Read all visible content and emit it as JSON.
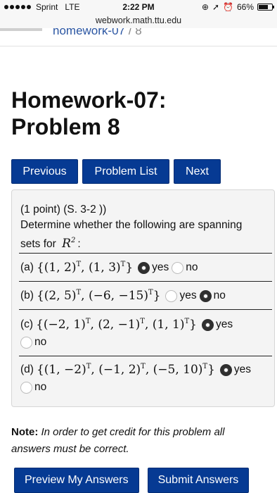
{
  "status_bar": {
    "carrier": "Sprint",
    "network": "LTE",
    "time": "2:22 PM",
    "battery": "66%",
    "icons": [
      "signal-dots-icon",
      "location-icon",
      "alarm-icon",
      "battery-icon"
    ]
  },
  "url": "webwork.math.ttu.edu",
  "breadcrumb": {
    "set": "nomework-07",
    "separator": "/",
    "problem": "8"
  },
  "title_line1": "Homework-07:",
  "title_line2": "Problem 8",
  "nav": {
    "previous": "Previous",
    "list": "Problem List",
    "next": "Next"
  },
  "problem": {
    "points": "(1 point)",
    "source": "(S. 3-2 ))",
    "prompt_line1": "Determine whether the following are spanning",
    "prompt_line2_prefix": "sets for",
    "space": "R",
    "space_exp": "2",
    "prompt_line2_suffix": ":",
    "questions": [
      {
        "label": "(a)",
        "set_open": "{(1, 2)",
        "t1": "T",
        "mid1": ", (1, 3)",
        "t2": "T",
        "set_close": "}",
        "yes": "yes",
        "no": "no",
        "selected": "yes"
      },
      {
        "label": "(b)",
        "set_open": "{(2, 5)",
        "t1": "T",
        "mid1": ", (−6, −15)",
        "t2": "T",
        "set_close": "}",
        "yes": "yes",
        "no": "no",
        "selected": "no"
      },
      {
        "label": "(c)",
        "set_open": "{(−2, 1)",
        "t1": "T",
        "mid1": ", (2, −1)",
        "t2": "T",
        "mid2": ", (1, 1)",
        "t3": "T",
        "set_close": "}",
        "yes": "yes",
        "no": "no",
        "selected": "yes"
      },
      {
        "label": "(d)",
        "set_open": "{(1, −2)",
        "t1": "T",
        "mid1": ", (−1, 2)",
        "t2": "T",
        "mid2": ", (−5, 10)",
        "t3": "T",
        "set_close": "}",
        "yes": "yes",
        "no": "no",
        "selected": "yes"
      }
    ]
  },
  "note": {
    "label": "Note:",
    "text": " In order to get credit for this problem all answers must be correct."
  },
  "actions": {
    "preview": "Preview My Answers",
    "submit": "Submit Answers"
  },
  "colors": {
    "button_bg": "#063a93",
    "link": "#2a55a2",
    "panel_bg": "#f4f4f4"
  }
}
